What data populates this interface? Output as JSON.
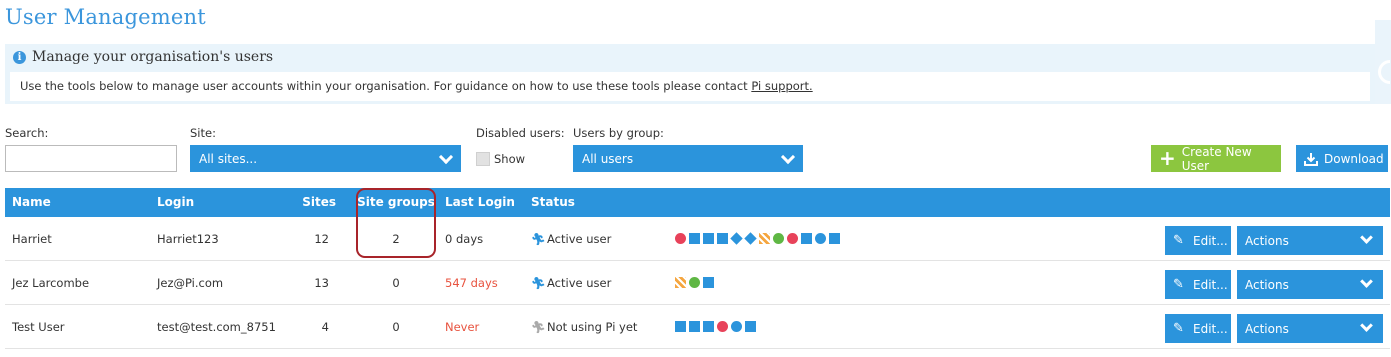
{
  "page": {
    "title": "User Management"
  },
  "info": {
    "heading": "Manage your organisation's users",
    "body_text": "Use the tools below to manage user accounts within your organisation. For guidance on how to use these tools please contact ",
    "link_text": "Pi support.",
    "icon": "info-icon"
  },
  "filters": {
    "search_label": "Search:",
    "search_value": "",
    "site_label": "Site:",
    "site_value": "All sites...",
    "disabled_label": "Disabled users:",
    "disabled_checkbox_label": "Show",
    "group_label": "Users by group:",
    "group_value": "All users"
  },
  "buttons": {
    "create_label": "Create New User",
    "download_label": "Download"
  },
  "table": {
    "headers": {
      "name": "Name",
      "login": "Login",
      "sites": "Sites",
      "site_groups": "Site groups",
      "last_login": "Last Login",
      "status": "Status"
    },
    "edit_label": "Edit...",
    "actions_label": "Actions",
    "rows": [
      {
        "name": "Harriet",
        "login": "Harriet123",
        "sites": "12",
        "site_groups": "2",
        "last_login": "0 days",
        "status": "Active user",
        "status_type": "active",
        "icons": [
          {
            "name": "apple-icon",
            "color": "#e8425a"
          },
          {
            "name": "truck-icon",
            "color": "#2b94dc"
          },
          {
            "name": "document-icon",
            "color": "#2b94dc"
          },
          {
            "name": "download-doc-icon",
            "color": "#2b94dc"
          },
          {
            "name": "tag-icon",
            "color": "#2b94dc"
          },
          {
            "name": "tags-icon",
            "color": "#2b94dc"
          },
          {
            "name": "checkered-icon",
            "color": "#f5a640"
          },
          {
            "name": "leaf-icon",
            "color": "#5fb744"
          },
          {
            "name": "piggy-bank-icon",
            "color": "#e8425a"
          },
          {
            "name": "check-box-icon",
            "color": "#2b94dc"
          },
          {
            "name": "clock-icon",
            "color": "#2b94dc"
          },
          {
            "name": "box-icon",
            "color": "#2b94dc"
          }
        ]
      },
      {
        "name": "Jez Larcombe",
        "login": "Jez@Pi.com",
        "sites": "13",
        "site_groups": "0",
        "last_login": "547 days",
        "status": "Active user",
        "status_type": "active",
        "icons": [
          {
            "name": "checkered-icon",
            "color": "#f5a640"
          },
          {
            "name": "leaf-icon",
            "color": "#5fb744"
          },
          {
            "name": "box-icon",
            "color": "#2b94dc"
          }
        ]
      },
      {
        "name": "Test User",
        "login": "test@test.com_8751",
        "sites": "4",
        "site_groups": "0",
        "last_login": "Never",
        "status": "Not using Pi yet",
        "status_type": "inactive",
        "icons": [
          {
            "name": "truck-icon",
            "color": "#2b94dc"
          },
          {
            "name": "document-icon",
            "color": "#2b94dc"
          },
          {
            "name": "download-doc-icon",
            "color": "#2b94dc"
          },
          {
            "name": "piggy-bank-icon",
            "color": "#e8425a"
          },
          {
            "name": "clock-icon",
            "color": "#2b94dc"
          },
          {
            "name": "box-icon",
            "color": "#2b94dc"
          }
        ]
      }
    ]
  },
  "colors": {
    "accent": "#2b94dc",
    "success": "#8cc63f",
    "warning_text": "#e8533f",
    "highlight_border": "#a8242a"
  }
}
